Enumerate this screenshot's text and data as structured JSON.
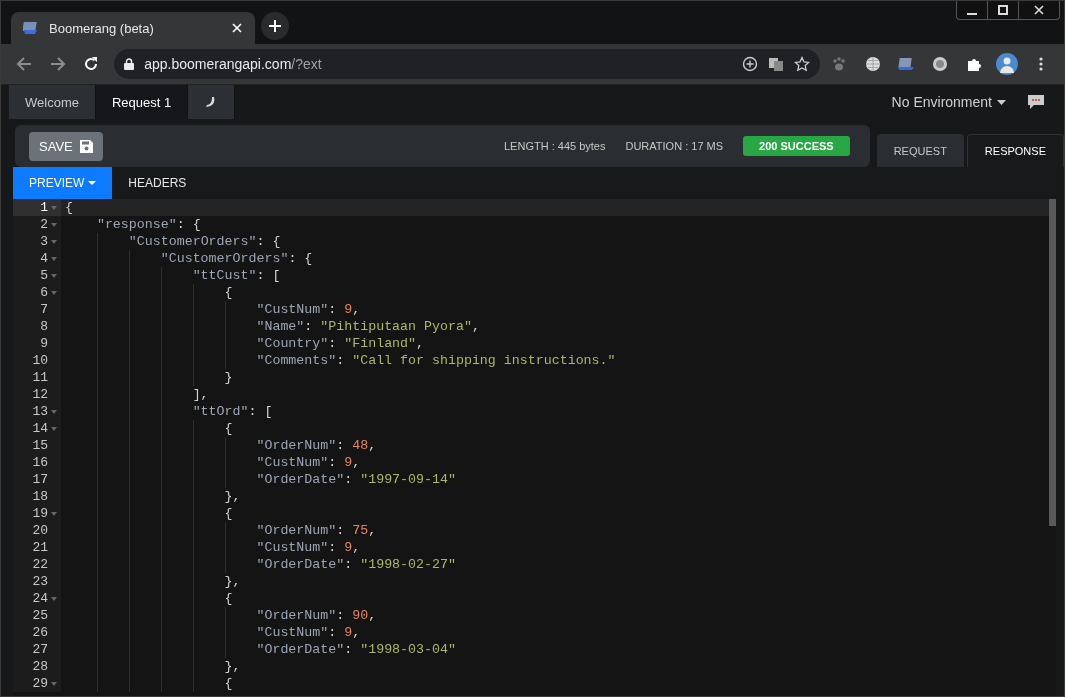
{
  "browser": {
    "tab_title": "Boomerang (beta)",
    "url_host": "app.boomerangapi.com",
    "url_path": "/?ext"
  },
  "app_tabs": [
    {
      "label": "Welcome",
      "selected": false
    },
    {
      "label": "Request 1",
      "selected": true
    },
    {
      "kind": "icon",
      "selected": false
    }
  ],
  "environment": "No Environment",
  "toolbar": {
    "save": "SAVE",
    "length": "LENGTH : 445 bytes",
    "duration": "DURATION : 17 MS",
    "status": "200 SUCCESS"
  },
  "panel_tabs": [
    {
      "label": "REQUEST",
      "selected": false
    },
    {
      "label": "RESPONSE",
      "selected": true
    }
  ],
  "view_tabs": [
    {
      "label": "PREVIEW",
      "selected": true
    },
    {
      "label": "HEADERS",
      "selected": false
    }
  ],
  "editor": {
    "lines": [
      {
        "number": "1",
        "fold": true,
        "active": true,
        "tokens": [
          {
            "kind": "punct",
            "text": "{"
          }
        ],
        "children": [
          {
            "number": "2",
            "fold": true,
            "active": false,
            "tokens": [
              {
                "kind": "key",
                "text": "\"response\""
              },
              {
                "kind": "punct",
                "text": ": {"
              }
            ],
            "children": [
              {
                "number": "3",
                "fold": true,
                "active": false,
                "tokens": [
                  {
                    "kind": "key",
                    "text": "\"CustomerOrders\""
                  },
                  {
                    "kind": "punct",
                    "text": ": {"
                  }
                ],
                "children": [
                  {
                    "number": "4",
                    "fold": true,
                    "active": false,
                    "tokens": [
                      {
                        "kind": "key",
                        "text": "\"CustomerOrders\""
                      },
                      {
                        "kind": "punct",
                        "text": ": {"
                      }
                    ],
                    "children": [
                      {
                        "number": "5",
                        "fold": true,
                        "active": false,
                        "tokens": [
                          {
                            "kind": "key",
                            "text": "\"ttCust\""
                          },
                          {
                            "kind": "punct",
                            "text": ": ["
                          }
                        ],
                        "children": [
                          {
                            "number": "6",
                            "fold": true,
                            "active": false,
                            "tokens": [
                              {
                                "kind": "punct",
                                "text": "{"
                              }
                            ],
                            "children": [
                              {
                                "number": "7",
                                "fold": false,
                                "active": false,
                                "tokens": [
                                  {
                                    "kind": "key",
                                    "text": "\"CustNum\""
                                  },
                                  {
                                    "kind": "punct",
                                    "text": ": "
                                  },
                                  {
                                    "kind": "number",
                                    "text": "9"
                                  },
                                  {
                                    "kind": "punct",
                                    "text": ","
                                  }
                                ]
                              },
                              {
                                "number": "8",
                                "fold": false,
                                "active": false,
                                "tokens": [
                                  {
                                    "kind": "key",
                                    "text": "\"Name\""
                                  },
                                  {
                                    "kind": "punct",
                                    "text": ": "
                                  },
                                  {
                                    "kind": "string",
                                    "text": "\"Pihtiputaan Pyora\""
                                  },
                                  {
                                    "kind": "punct",
                                    "text": ","
                                  }
                                ]
                              },
                              {
                                "number": "9",
                                "fold": false,
                                "active": false,
                                "tokens": [
                                  {
                                    "kind": "key",
                                    "text": "\"Country\""
                                  },
                                  {
                                    "kind": "punct",
                                    "text": ": "
                                  },
                                  {
                                    "kind": "string",
                                    "text": "\"Finland\""
                                  },
                                  {
                                    "kind": "punct",
                                    "text": ","
                                  }
                                ]
                              },
                              {
                                "number": "10",
                                "fold": false,
                                "active": false,
                                "tokens": [
                                  {
                                    "kind": "key",
                                    "text": "\"Comments\""
                                  },
                                  {
                                    "kind": "punct",
                                    "text": ": "
                                  },
                                  {
                                    "kind": "string",
                                    "text": "\"Call for shipping instructions.\""
                                  }
                                ]
                              }
                            ]
                          },
                          {
                            "number": "11",
                            "fold": false,
                            "active": false,
                            "tokens": [
                              {
                                "kind": "punct",
                                "text": "}"
                              }
                            ]
                          }
                        ]
                      },
                      {
                        "number": "12",
                        "fold": false,
                        "active": false,
                        "tokens": [
                          {
                            "kind": "punct",
                            "text": "],"
                          }
                        ]
                      },
                      {
                        "number": "13",
                        "fold": true,
                        "active": false,
                        "tokens": [
                          {
                            "kind": "key",
                            "text": "\"ttOrd\""
                          },
                          {
                            "kind": "punct",
                            "text": ": ["
                          }
                        ],
                        "children": [
                          {
                            "number": "14",
                            "fold": true,
                            "active": false,
                            "tokens": [
                              {
                                "kind": "punct",
                                "text": "{"
                              }
                            ],
                            "children": [
                              {
                                "number": "15",
                                "fold": false,
                                "active": false,
                                "tokens": [
                                  {
                                    "kind": "key",
                                    "text": "\"OrderNum\""
                                  },
                                  {
                                    "kind": "punct",
                                    "text": ": "
                                  },
                                  {
                                    "kind": "number",
                                    "text": "48"
                                  },
                                  {
                                    "kind": "punct",
                                    "text": ","
                                  }
                                ]
                              },
                              {
                                "number": "16",
                                "fold": false,
                                "active": false,
                                "tokens": [
                                  {
                                    "kind": "key",
                                    "text": "\"CustNum\""
                                  },
                                  {
                                    "kind": "punct",
                                    "text": ": "
                                  },
                                  {
                                    "kind": "number",
                                    "text": "9"
                                  },
                                  {
                                    "kind": "punct",
                                    "text": ","
                                  }
                                ]
                              },
                              {
                                "number": "17",
                                "fold": false,
                                "active": false,
                                "tokens": [
                                  {
                                    "kind": "key",
                                    "text": "\"OrderDate\""
                                  },
                                  {
                                    "kind": "punct",
                                    "text": ": "
                                  },
                                  {
                                    "kind": "string",
                                    "text": "\"1997-09-14\""
                                  }
                                ]
                              }
                            ]
                          },
                          {
                            "number": "18",
                            "fold": false,
                            "active": false,
                            "tokens": [
                              {
                                "kind": "punct",
                                "text": "},"
                              }
                            ]
                          },
                          {
                            "number": "19",
                            "fold": true,
                            "active": false,
                            "tokens": [
                              {
                                "kind": "punct",
                                "text": "{"
                              }
                            ],
                            "children": [
                              {
                                "number": "20",
                                "fold": false,
                                "active": false,
                                "tokens": [
                                  {
                                    "kind": "key",
                                    "text": "\"OrderNum\""
                                  },
                                  {
                                    "kind": "punct",
                                    "text": ": "
                                  },
                                  {
                                    "kind": "number",
                                    "text": "75"
                                  },
                                  {
                                    "kind": "punct",
                                    "text": ","
                                  }
                                ]
                              },
                              {
                                "number": "21",
                                "fold": false,
                                "active": false,
                                "tokens": [
                                  {
                                    "kind": "key",
                                    "text": "\"CustNum\""
                                  },
                                  {
                                    "kind": "punct",
                                    "text": ": "
                                  },
                                  {
                                    "kind": "number",
                                    "text": "9"
                                  },
                                  {
                                    "kind": "punct",
                                    "text": ","
                                  }
                                ]
                              },
                              {
                                "number": "22",
                                "fold": false,
                                "active": false,
                                "tokens": [
                                  {
                                    "kind": "key",
                                    "text": "\"OrderDate\""
                                  },
                                  {
                                    "kind": "punct",
                                    "text": ": "
                                  },
                                  {
                                    "kind": "string",
                                    "text": "\"1998-02-27\""
                                  }
                                ]
                              }
                            ]
                          },
                          {
                            "number": "23",
                            "fold": false,
                            "active": false,
                            "tokens": [
                              {
                                "kind": "punct",
                                "text": "},"
                              }
                            ]
                          },
                          {
                            "number": "24",
                            "fold": true,
                            "active": false,
                            "tokens": [
                              {
                                "kind": "punct",
                                "text": "{"
                              }
                            ],
                            "children": [
                              {
                                "number": "25",
                                "fold": false,
                                "active": false,
                                "tokens": [
                                  {
                                    "kind": "key",
                                    "text": "\"OrderNum\""
                                  },
                                  {
                                    "kind": "punct",
                                    "text": ": "
                                  },
                                  {
                                    "kind": "number",
                                    "text": "90"
                                  },
                                  {
                                    "kind": "punct",
                                    "text": ","
                                  }
                                ]
                              },
                              {
                                "number": "26",
                                "fold": false,
                                "active": false,
                                "tokens": [
                                  {
                                    "kind": "key",
                                    "text": "\"CustNum\""
                                  },
                                  {
                                    "kind": "punct",
                                    "text": ": "
                                  },
                                  {
                                    "kind": "number",
                                    "text": "9"
                                  },
                                  {
                                    "kind": "punct",
                                    "text": ","
                                  }
                                ]
                              },
                              {
                                "number": "27",
                                "fold": false,
                                "active": false,
                                "tokens": [
                                  {
                                    "kind": "key",
                                    "text": "\"OrderDate\""
                                  },
                                  {
                                    "kind": "punct",
                                    "text": ": "
                                  },
                                  {
                                    "kind": "string",
                                    "text": "\"1998-03-04\""
                                  }
                                ]
                              }
                            ]
                          },
                          {
                            "number": "28",
                            "fold": false,
                            "active": false,
                            "tokens": [
                              {
                                "kind": "punct",
                                "text": "},"
                              }
                            ]
                          },
                          {
                            "number": "29",
                            "fold": true,
                            "active": false,
                            "tokens": [
                              {
                                "kind": "punct",
                                "text": "{"
                              }
                            ]
                          }
                        ]
                      }
                    ]
                  }
                ]
              }
            ]
          }
        ]
      }
    ]
  }
}
